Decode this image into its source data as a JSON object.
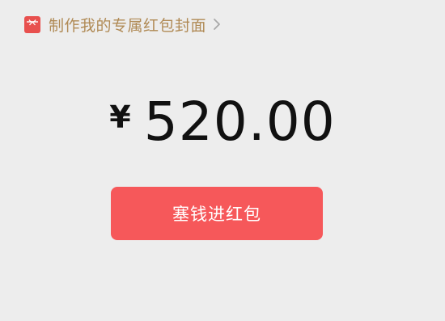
{
  "cover": {
    "label": "制作我的专属红包封面",
    "icon": "red-envelope-icon",
    "chevron_icon": "chevron-right-icon",
    "label_color": "#b08a55",
    "icon_color": "#e8504e"
  },
  "amount": {
    "currency": "¥",
    "value": "520.00"
  },
  "action": {
    "label": "塞钱进红包",
    "color": "#f6585a"
  }
}
